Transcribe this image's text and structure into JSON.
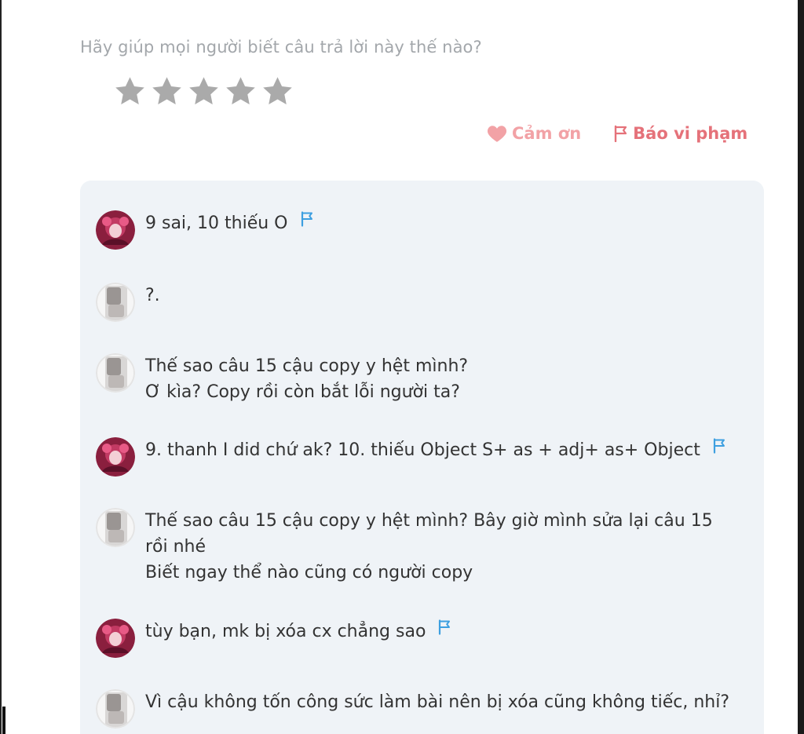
{
  "rating": {
    "prompt": "Hãy giúp mọi người biết câu trả lời này thế nào?",
    "stars_total": 5,
    "stars_filled": 0,
    "star_color": "#aaaaaa"
  },
  "actions": {
    "thanks_label": "Cảm ơn",
    "report_label": "Báo vi phạm",
    "thanks_color": "#f2a2a6",
    "report_color": "#e5727a"
  },
  "comments": [
    {
      "avatar": "anime-avatar",
      "lines": [
        "9 sai, 10 thiếu O"
      ],
      "flag": true
    },
    {
      "avatar": "grey-avatar",
      "lines": [
        "?."
      ],
      "flag": false
    },
    {
      "avatar": "grey-avatar",
      "lines": [
        "Thế sao câu 15 cậu copy y hệt mình?",
        "Ơ kìa? Copy rồi còn bắt lỗi người ta?"
      ],
      "flag": false
    },
    {
      "avatar": "anime-avatar",
      "lines": [
        "9. thanh I did chứ ak? 10. thiếu Object S+ as + adj+ as+ Object"
      ],
      "flag": true
    },
    {
      "avatar": "grey-avatar",
      "lines": [
        "Thế sao câu 15 cậu copy y hệt mình? Bây giờ mình sửa lại câu 15 rồi nhé",
        "Biết ngay thể nào cũng có người copy"
      ],
      "flag": false
    },
    {
      "avatar": "anime-avatar",
      "lines": [
        "tùy bạn, mk bị xóa cx chẳng sao"
      ],
      "flag": true
    },
    {
      "avatar": "grey-avatar",
      "lines": [
        "Vì cậu không tốn công sức làm bài nên bị xóa cũng không tiếc, nhỉ?"
      ],
      "flag": false
    }
  ],
  "colors": {
    "panel_bg": "#eff3f7",
    "flag_blue": "#3d9fe0",
    "text": "#333333"
  }
}
